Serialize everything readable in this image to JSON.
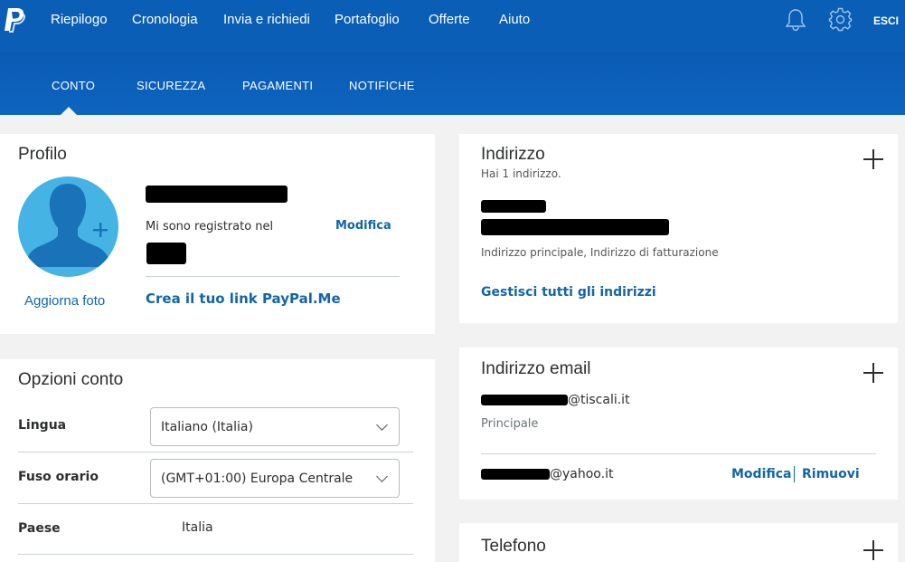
{
  "topnav": {
    "items": [
      "Riepilogo",
      "Cronologia",
      "Invia e richiedi",
      "Portafoglio",
      "Offerte",
      "Aiuto"
    ],
    "logout": "ESCI"
  },
  "subnav": {
    "items": [
      "CONTO",
      "SICUREZZA",
      "PAGAMENTI",
      "NOTIFICHE"
    ],
    "active": "CONTO"
  },
  "profile": {
    "title": "Profilo",
    "update_photo": "Aggiorna foto",
    "registered_label": "Mi sono registrato nel",
    "edit": "Modifica",
    "paypalme_link": "Crea il tuo link PayPal.Me"
  },
  "account_options": {
    "title": "Opzioni conto",
    "language": {
      "label": "Lingua",
      "value": "Italiano (Italia)"
    },
    "timezone": {
      "label": "Fuso orario",
      "value": "(GMT+01:00) Europa Centrale"
    },
    "country": {
      "label": "Paese",
      "value": "Italia"
    }
  },
  "address": {
    "title": "Indirizzo",
    "count": "Hai 1 indirizzo.",
    "tags": "Indirizzo principale, Indirizzo di fatturazione",
    "manage_link": "Gestisci tutti gli indirizzi"
  },
  "email": {
    "title": "Indirizzo email",
    "primary_domain": "@tiscali.it",
    "primary_tag": "Principale",
    "secondary_domain": "@yahoo.it",
    "edit": "Modifica",
    "remove": "Rimuovi"
  },
  "phone": {
    "title": "Telefono"
  },
  "colors": {
    "primary_blue": "#0b5eb5",
    "link_blue": "#1266a8",
    "avatar_blue": "#45b4e5"
  }
}
